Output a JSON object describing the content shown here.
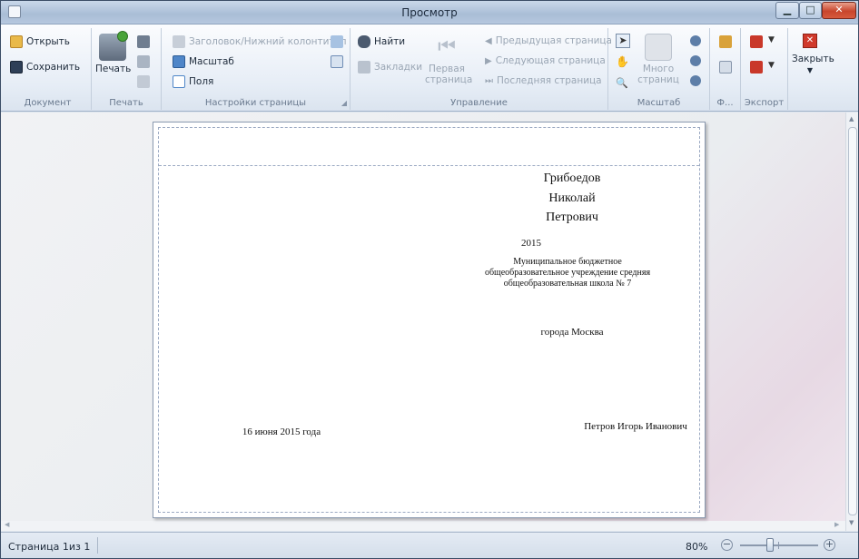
{
  "window": {
    "title": "Просмотр"
  },
  "ribbon": {
    "document": {
      "open": "Открыть",
      "save": "Сохранить",
      "label": "Документ"
    },
    "print": {
      "print": "Печать",
      "label": "Печать"
    },
    "page_setup": {
      "header_footer": "Заголовок/Нижний колонтитул",
      "scale": "Масштаб",
      "margins": "Поля",
      "label": "Настройки страницы"
    },
    "navigation": {
      "find": "Найти",
      "bookmarks": "Закладки",
      "first_page_l1": "Первая",
      "first_page_l2": "страница",
      "prev_page": "Предыдущая страница",
      "next_page": "Следующая страница",
      "last_page": "Последняя страница",
      "label": "Управление"
    },
    "zoom": {
      "many_l1": "Много",
      "many_l2": "страниц",
      "label": "Масштаб"
    },
    "background": {
      "label": "Ф..."
    },
    "export": {
      "label": "Экспорт"
    },
    "close": {
      "label": "Закрыть"
    }
  },
  "document": {
    "surname": "Грибоедов",
    "name": "Николай",
    "patronymic": "Петрович",
    "year": "2015",
    "school_l1": "Муниципальное бюджетное",
    "school_l2": "общеобразовательное учреждение средняя",
    "school_l3": "общеобразовательная школа № 7",
    "city": "города Москва",
    "date": "16 июня 2015 года",
    "signatory": "Петров Игорь Иванович"
  },
  "status": {
    "page_info": "Страница 1из 1",
    "zoom": "80%",
    "zoom_level": 0.5
  },
  "colors": {
    "titlebar": "#b6c8df",
    "close_button": "#c8452c",
    "ribbon": "#e6edf6",
    "workspace": "#eaedf0",
    "page": "#ffffff"
  }
}
